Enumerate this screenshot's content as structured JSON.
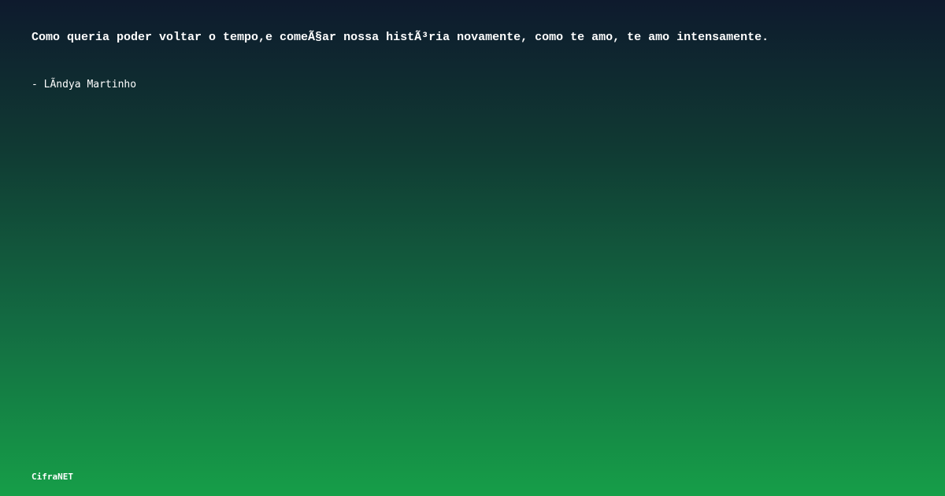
{
  "quote": {
    "text": "Como queria poder voltar o tempo,e comeÃ§ar nossa histÃ³ria novamente, como te amo, te amo intensamente.",
    "author": "- LÃ­ndya Martinho"
  },
  "footer": {
    "brand": "CifraNET"
  },
  "colors": {
    "background_top": "#0e1a2d",
    "background_bottom": "#169e48",
    "text": "#ffffff"
  }
}
